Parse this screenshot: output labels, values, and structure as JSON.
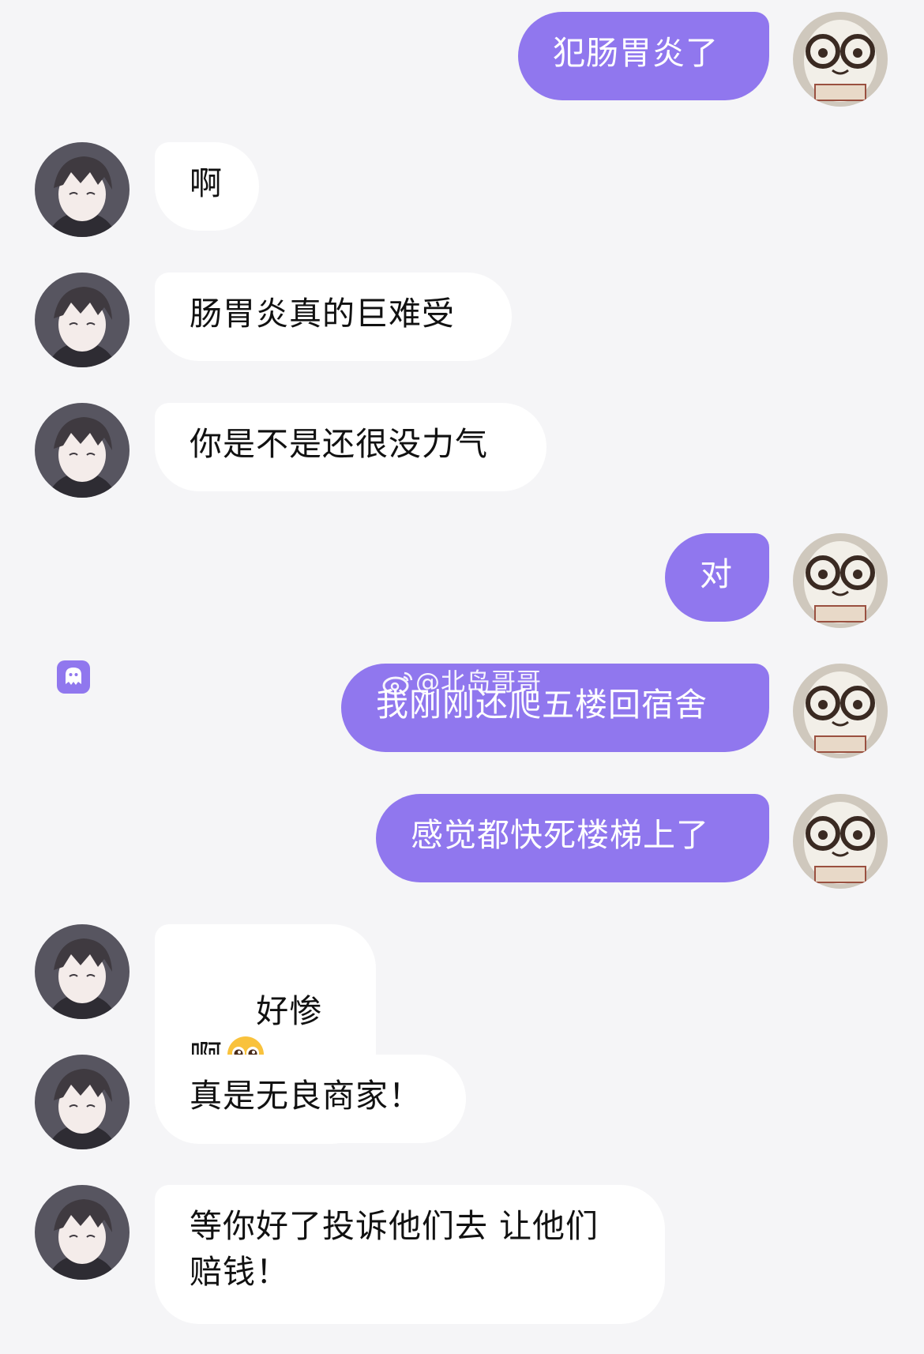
{
  "colors": {
    "background": "#f5f5f7",
    "outgoing_bubble": "#9077ee",
    "incoming_bubble": "#ffffff"
  },
  "messages": [
    {
      "side": "out",
      "text": "犯肠胃炎了"
    },
    {
      "side": "in",
      "text": "啊"
    },
    {
      "side": "in",
      "text": "肠胃炎真的巨难受"
    },
    {
      "side": "in",
      "text": "你是不是还很没力气"
    },
    {
      "side": "out",
      "text": "对"
    },
    {
      "side": "out",
      "text": "我刚刚还爬五楼回宿舍"
    },
    {
      "side": "out",
      "text": "感觉都快死楼梯上了"
    },
    {
      "side": "in",
      "text": "好惨啊",
      "emoji": "pleading-face-emoji"
    },
    {
      "side": "in",
      "text": "真是无良商家！"
    },
    {
      "side": "in",
      "text": "等你好了投诉他们去 让他们\n赔钱！"
    }
  ],
  "watermark": {
    "text": "@北岛哥哥",
    "icon": "weibo-icon"
  },
  "app_badge": {
    "icon": "ghost-app-icon"
  }
}
